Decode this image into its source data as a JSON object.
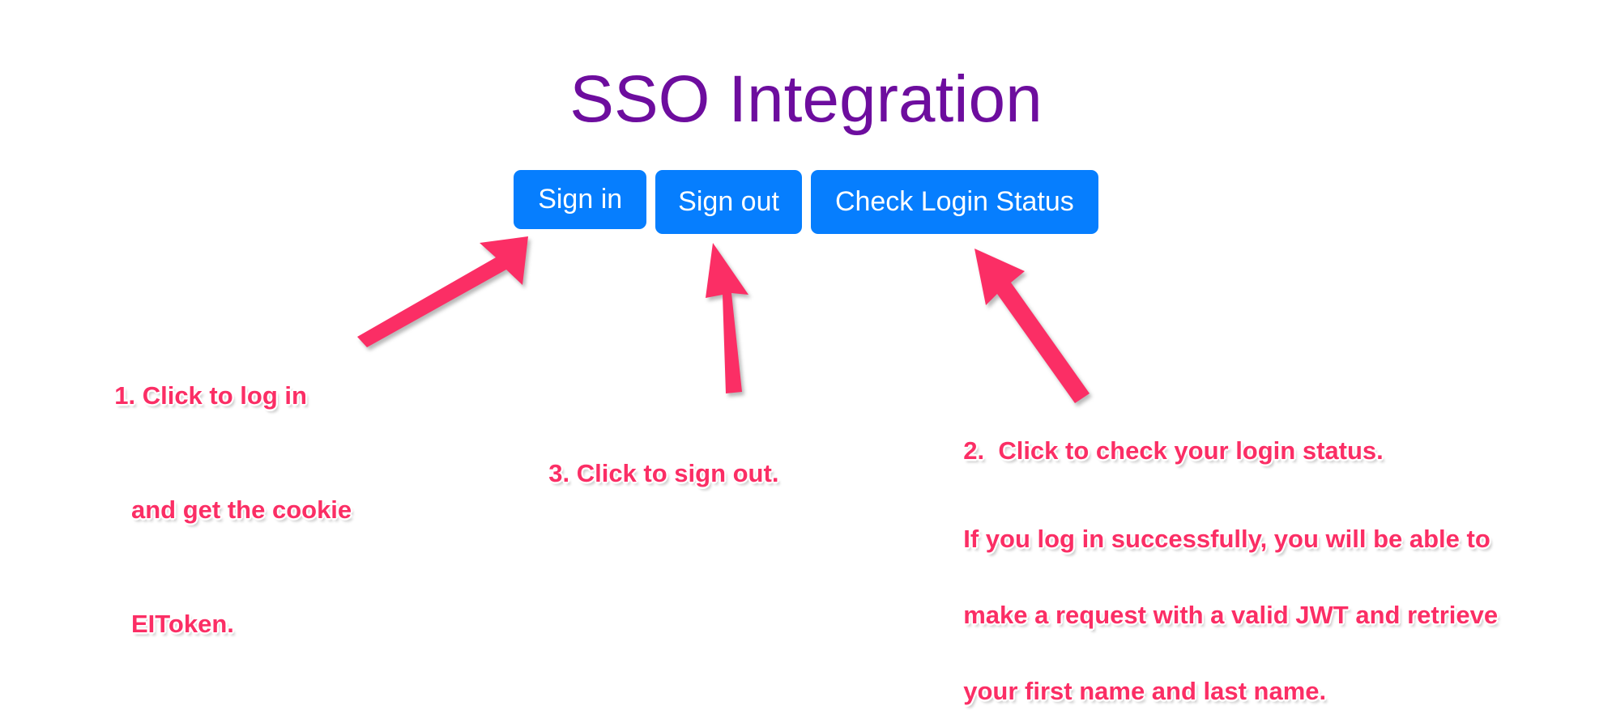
{
  "page": {
    "title": "SSO Integration",
    "title_color": "#6d0d9e",
    "background_color": "#ffffff"
  },
  "buttons": {
    "color": "#067efe",
    "text_color": "#ffffff",
    "items": [
      {
        "id": "sign-in",
        "label": "Sign in"
      },
      {
        "id": "sign-out",
        "label": "Sign out"
      },
      {
        "id": "check-login-status",
        "label": "Check Login Status"
      }
    ]
  },
  "annotations": {
    "color": "#fb2e65",
    "step1": {
      "line1": "1. Click to log in",
      "line2": "and get the cookie",
      "line3": "EIToken."
    },
    "step3": {
      "line1": "3. Click to sign out."
    },
    "step2": {
      "line1": "2.  Click to check your login status.",
      "detail_line1": "If you log in successfully, you will be able to",
      "detail_line2": "make a request with a valid JWT and retrieve",
      "detail_line3": "your first name and last name."
    }
  },
  "arrows": [
    {
      "id": "arrow-to-sign-in",
      "points_to": "sign-in",
      "direction": "up-right"
    },
    {
      "id": "arrow-to-sign-out",
      "points_to": "sign-out",
      "direction": "up"
    },
    {
      "id": "arrow-to-check-login-status",
      "points_to": "check-login-status",
      "direction": "up-left"
    }
  ]
}
